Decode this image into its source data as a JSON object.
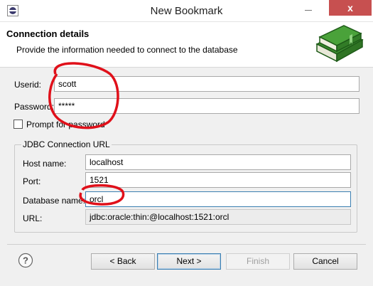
{
  "window": {
    "title": "New Bookmark",
    "close_glyph": "x"
  },
  "header": {
    "title": "Connection details",
    "description": "Provide the information needed to connect to the database",
    "icon": "books-icon"
  },
  "form": {
    "userid_label": "Userid:",
    "userid_value": "scott",
    "password_label": "Password:",
    "password_value": "*****",
    "prompt_label": "Prompt for password",
    "prompt_checked": false
  },
  "jdbc": {
    "group_title": "JDBC Connection URL",
    "host_label": "Host name:",
    "host_value": "localhost",
    "port_label": "Port:",
    "port_value": "1521",
    "db_label": "Database name:",
    "db_value": "orcl",
    "url_label": "URL:",
    "url_value": "jdbc:oracle:thin:@localhost:1521:orcl"
  },
  "buttons": {
    "help": "?",
    "back": "< Back",
    "next": "Next >",
    "finish": "Finish",
    "cancel": "Cancel"
  },
  "colors": {
    "annotation": "#e0101a",
    "accent": "#3c7fb1"
  }
}
